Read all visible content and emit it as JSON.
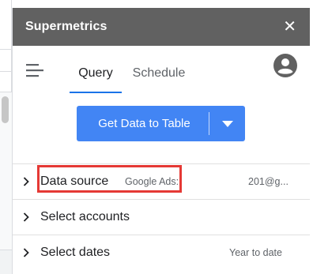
{
  "panel": {
    "title": "Supermetrics",
    "close_glyph": "✕"
  },
  "nav": {
    "tabs": [
      {
        "label": "Query",
        "active": true
      },
      {
        "label": "Schedule",
        "active": false
      }
    ]
  },
  "action": {
    "primary_label": "Get Data to Table"
  },
  "rows": {
    "data_source": {
      "label": "Data source",
      "value": "Google Ads:",
      "value_suffix": "201@g..."
    },
    "accounts": {
      "label": "Select accounts",
      "value": ""
    },
    "dates": {
      "label": "Select dates",
      "value": "Year to date"
    }
  },
  "colors": {
    "title_bar": "#616161",
    "accent": "#4285f4",
    "tab_underline": "#1a73e8",
    "highlight": "#e53935"
  },
  "icons": [
    "hamburger-menu-icon",
    "user-avatar-icon",
    "close-icon",
    "chevron-down-icon",
    "chevron-right-icon"
  ]
}
